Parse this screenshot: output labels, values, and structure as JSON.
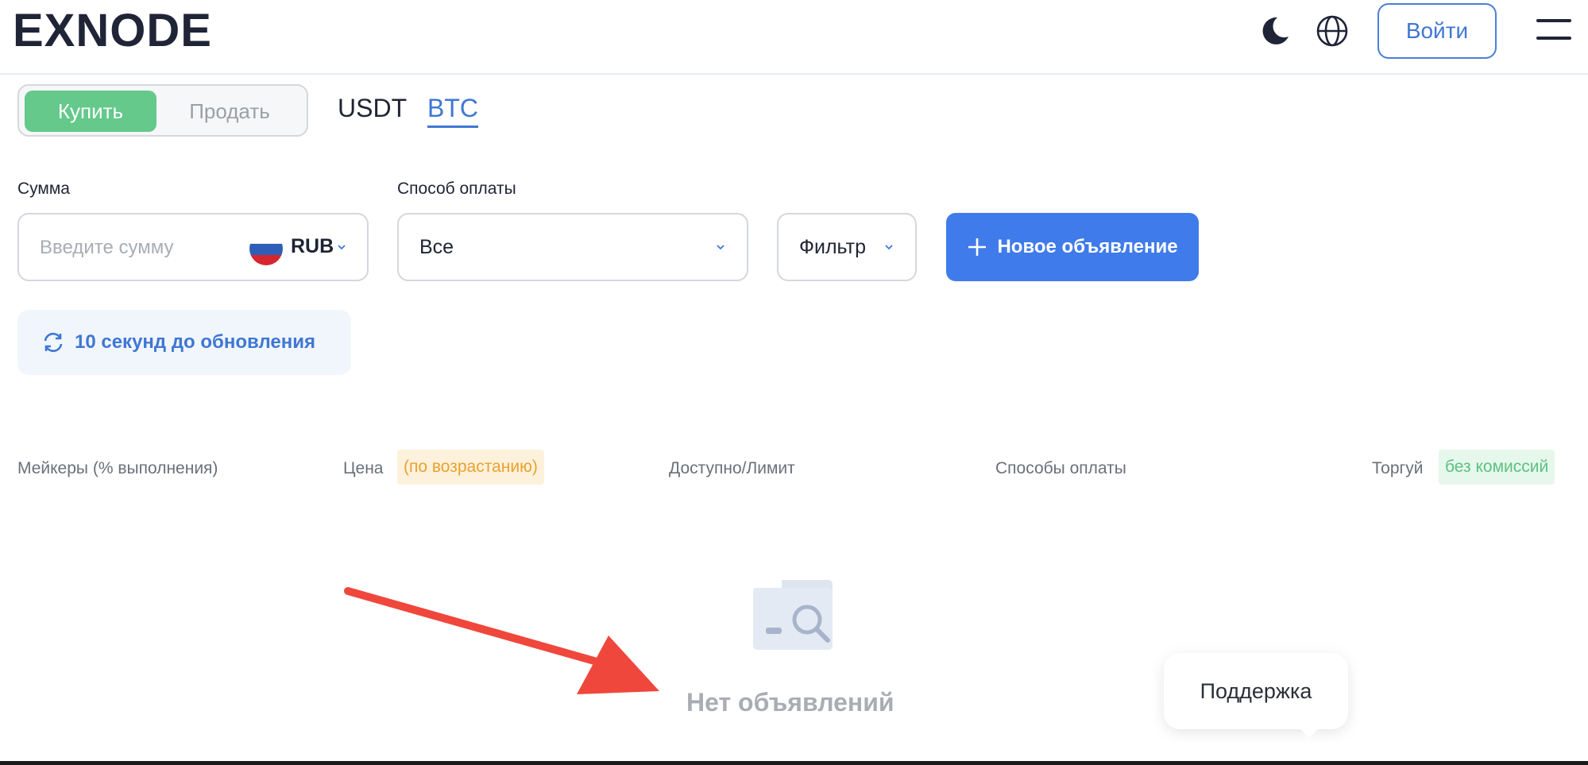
{
  "header": {
    "logo": "EXNODE",
    "theme_icon": "moon-icon",
    "language_icon": "globe-icon",
    "login_label": "Войти",
    "menu_icon": "hamburger-icon"
  },
  "trade_toggle": {
    "buy_label": "Купить",
    "sell_label": "Продать",
    "selected": "buy"
  },
  "coins": {
    "items": [
      "USDT",
      "BTC"
    ],
    "active": "BTC"
  },
  "filters": {
    "amount_label": "Сумма",
    "amount_placeholder": "Введите сумму",
    "currency": "RUB",
    "payment_label": "Способ оплаты",
    "payment_value": "Все",
    "filter_label": "Фильтр",
    "new_ad_label": "Новое объявление"
  },
  "refresh": {
    "text": "10 секунд до обновления"
  },
  "table_header": {
    "makers": "Мейкеры (% выполнения)",
    "price": "Цена",
    "price_sort": "(по возрастанию)",
    "available": "Доступно/Лимит",
    "payment_methods": "Способы оплаты",
    "trade": "Торгуй",
    "no_fee": "без комиссий"
  },
  "empty_state": {
    "text": "Нет объявлений",
    "icon": "folder-search-icon"
  },
  "support": {
    "label": "Поддержка"
  },
  "colors": {
    "accent": "#3f7bea",
    "buy": "#64c98a",
    "arrow": "#f0473c"
  }
}
